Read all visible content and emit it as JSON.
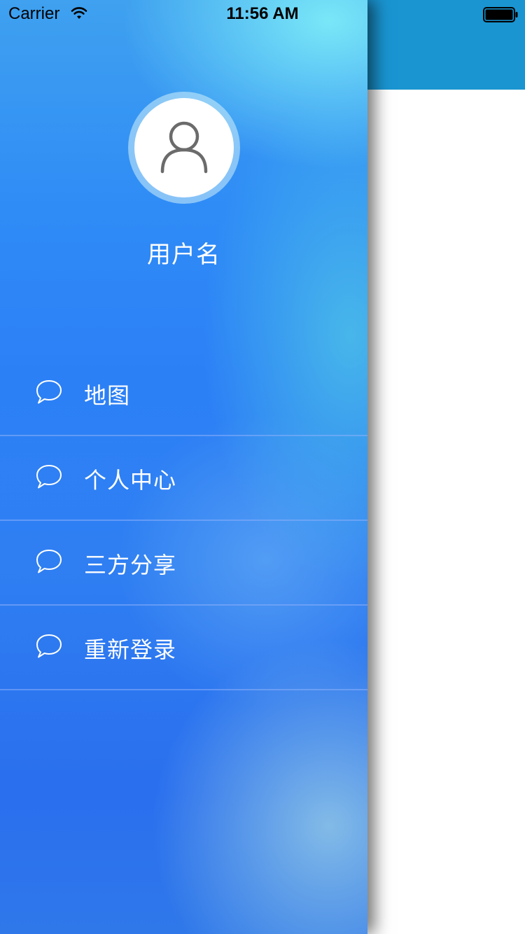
{
  "status_bar": {
    "carrier": "Carrier",
    "time": "11:56 AM",
    "wifi_icon": "wifi-icon",
    "battery_icon": "battery-icon"
  },
  "main": {
    "navbar_color": "#1a95d1",
    "background_color": "#ffffff"
  },
  "drawer": {
    "accent_color": "#2f80f5",
    "profile": {
      "avatar_icon": "user-icon",
      "username": "用户名"
    },
    "menu": [
      {
        "icon": "chat-bubble-icon",
        "label": "地图"
      },
      {
        "icon": "chat-bubble-icon",
        "label": "个人中心"
      },
      {
        "icon": "chat-bubble-icon",
        "label": "三方分享"
      },
      {
        "icon": "chat-bubble-icon",
        "label": "重新登录"
      }
    ]
  }
}
